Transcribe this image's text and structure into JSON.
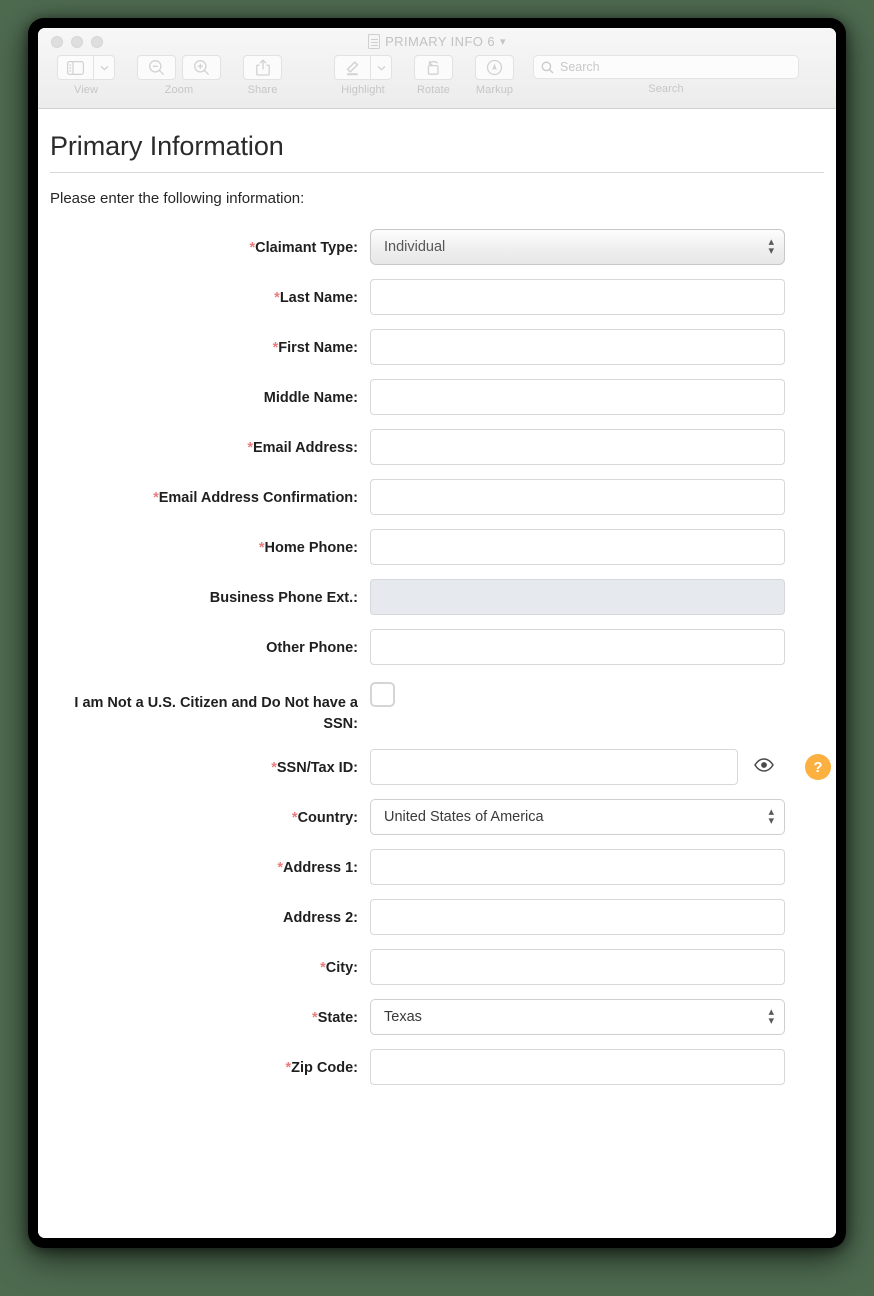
{
  "window": {
    "doc_title": "PRIMARY INFO 6",
    "title_chevron": "chevron-down",
    "traffic_lights": [
      "close",
      "minimize",
      "zoom"
    ]
  },
  "toolbar": {
    "groups": [
      {
        "label": "View",
        "buttons": [
          "sidebar-icon",
          "chevron-down-icon"
        ]
      },
      {
        "label": "Zoom",
        "buttons": [
          "zoom-out-icon",
          "zoom-in-icon"
        ]
      },
      {
        "label": "Share",
        "buttons": [
          "share-icon"
        ]
      },
      {
        "label": "Highlight",
        "buttons": [
          "highlight-pen-icon",
          "chevron-down-icon"
        ]
      },
      {
        "label": "Rotate",
        "buttons": [
          "rotate-icon"
        ]
      },
      {
        "label": "Markup",
        "buttons": [
          "markup-icon"
        ]
      },
      {
        "label": "Search",
        "buttons": [
          "search-icon"
        ]
      }
    ],
    "view_label": "View",
    "zoom_label": "Zoom",
    "share_label": "Share",
    "highlight_label": "Highlight",
    "rotate_label": "Rotate",
    "markup_label": "Markup",
    "search_label": "Search",
    "search_placeholder": "Search",
    "search_value": ""
  },
  "document": {
    "title": "Primary Information",
    "intro": "Please enter the following information:",
    "fields": [
      {
        "label": "Claimant Type:",
        "required": true,
        "type": "select-gradient",
        "value": "Individual"
      },
      {
        "label": "Last Name:",
        "required": true,
        "type": "text",
        "value": ""
      },
      {
        "label": "First Name:",
        "required": true,
        "type": "text",
        "value": ""
      },
      {
        "label": "Middle Name:",
        "required": false,
        "type": "text",
        "value": ""
      },
      {
        "label": "Email Address:",
        "required": true,
        "type": "text",
        "value": ""
      },
      {
        "label": "Email Address Confirmation:",
        "required": true,
        "type": "text",
        "value": ""
      },
      {
        "label": "Home Phone:",
        "required": true,
        "type": "text",
        "value": ""
      },
      {
        "label": "Business Phone Ext.:",
        "required": false,
        "type": "text-disabled",
        "value": ""
      },
      {
        "label": "Other Phone:",
        "required": false,
        "type": "text",
        "value": ""
      },
      {
        "label": "I am Not a U.S. Citizen and Do Not have a SSN:",
        "required": false,
        "type": "checkbox",
        "checked": false
      },
      {
        "label": "SSN/Tax ID:",
        "required": true,
        "type": "text-secure",
        "value": "",
        "reveal_icon": "eye-icon",
        "help_label": "?"
      },
      {
        "label": "Country:",
        "required": true,
        "type": "select",
        "value": "United States of America"
      },
      {
        "label": "Address 1:",
        "required": true,
        "type": "text",
        "value": ""
      },
      {
        "label": "Address 2:",
        "required": false,
        "type": "text",
        "value": ""
      },
      {
        "label": "City:",
        "required": true,
        "type": "text",
        "value": ""
      },
      {
        "label": "State:",
        "required": true,
        "type": "select",
        "value": "Texas"
      },
      {
        "label": "Zip Code:",
        "required": true,
        "type": "text",
        "value": ""
      }
    ]
  },
  "colors": {
    "required_asterisk": "#e97d7d",
    "help_button": "#fbb040",
    "desktop": "#4e6b50",
    "disabled_field": "#e6e9ed"
  }
}
